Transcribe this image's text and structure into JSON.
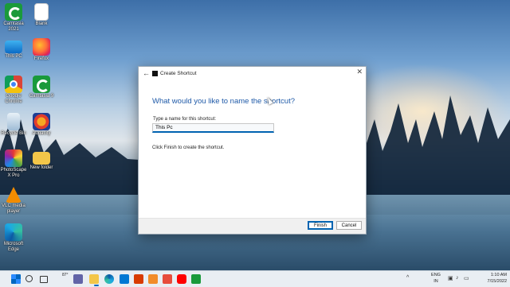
{
  "desktop_icons": [
    {
      "label_line1": "Camtasia",
      "label_line2": "2021",
      "icon": "camtasia-icon"
    },
    {
      "label_line1": "Blank",
      "label_line2": "",
      "icon": "blank-document-icon"
    },
    {
      "label_line1": "This PC",
      "label_line2": "",
      "icon": "this-pc-icon"
    },
    {
      "label_line1": "Firefox",
      "label_line2": "",
      "icon": "firefox-icon"
    },
    {
      "label_line1": "Google",
      "label_line2": "Chrome",
      "icon": "chrome-icon"
    },
    {
      "label_line1": "Camtasia 9",
      "label_line2": "",
      "icon": "camtasia-icon"
    },
    {
      "label_line1": "Recycle Bin",
      "label_line2": "",
      "icon": "recycle-bin-icon"
    },
    {
      "label_line1": "Audacity",
      "label_line2": "",
      "icon": "audacity-icon"
    },
    {
      "label_line1": "PhotoScape",
      "label_line2": "X Pro",
      "icon": "photoscape-icon"
    },
    {
      "label_line1": "New folder",
      "label_line2": "",
      "icon": "folder-icon"
    },
    {
      "label_line1": "VLC media",
      "label_line2": "player",
      "icon": "vlc-icon"
    },
    {
      "label_line1": "Microsoft",
      "label_line2": "Edge",
      "icon": "edge-icon"
    }
  ],
  "dialog": {
    "title": "Create Shortcut",
    "back_glyph": "←",
    "close_glyph": "✕",
    "heading": "What would you like to name the shortcut?",
    "field_label": "Type a name for this shortcut:",
    "name_value": "This Pc",
    "hint": "Click Finish to create the shortcut.",
    "finish_label": "Finish",
    "cancel_label": "Cancel"
  },
  "taskbar": {
    "weather": "87°",
    "tray_chevron": "^",
    "lang_line1": "ENG",
    "lang_line2": "IN",
    "time": "1:10 AM",
    "date": "7/15/2022"
  },
  "colors": {
    "accent": "#0063b1",
    "heading": "#1f5aa8",
    "taskbar_bg": "#e9eef3"
  }
}
